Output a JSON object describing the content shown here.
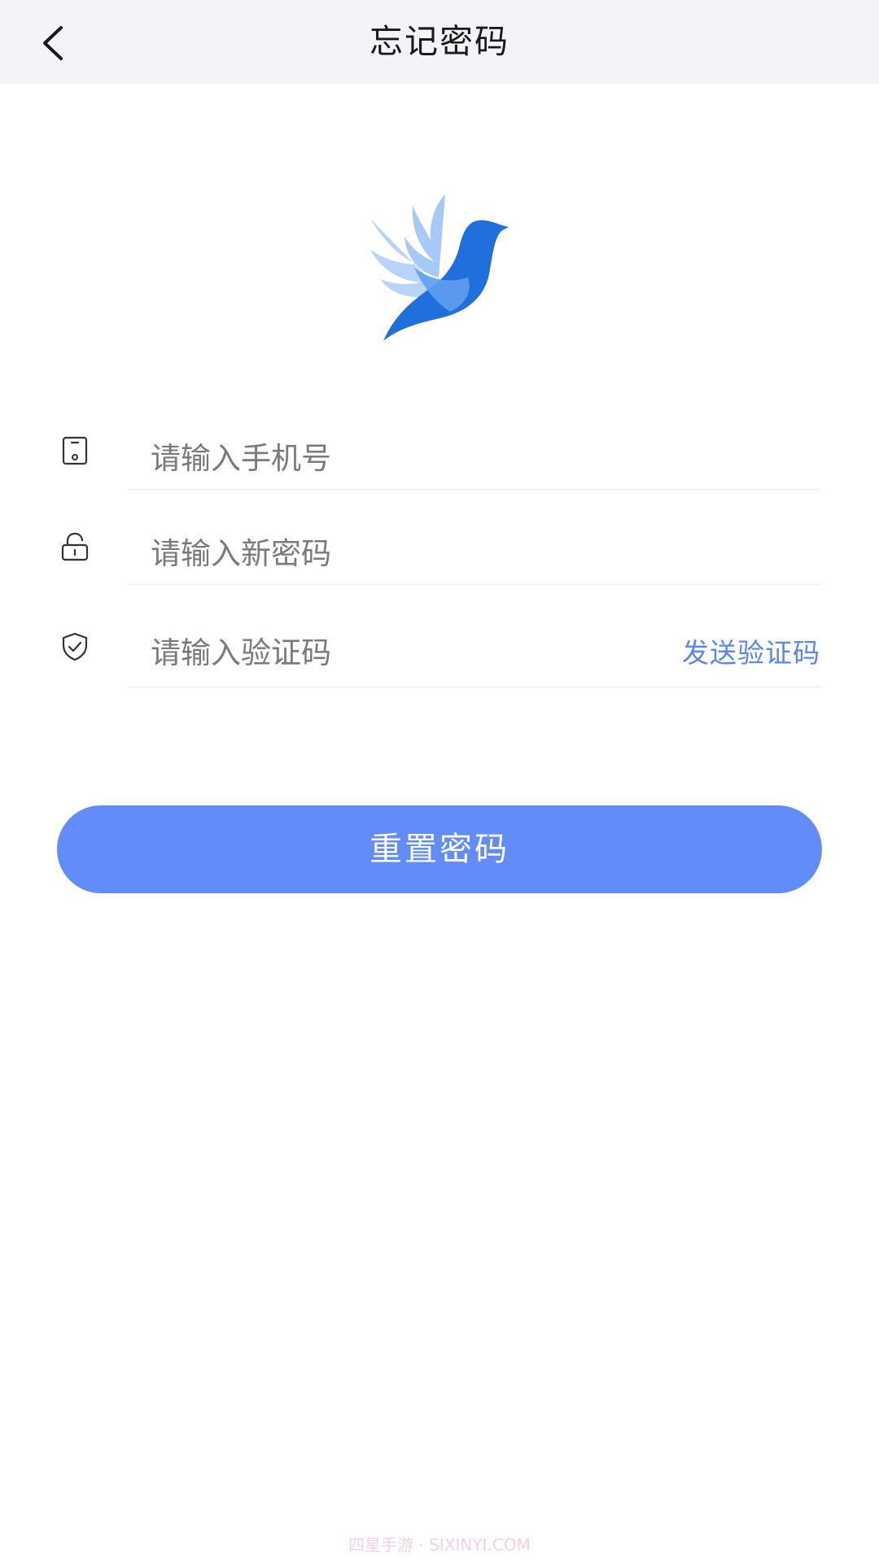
{
  "navbar": {
    "title": "忘记密码",
    "back_icon": "chevron-left-icon"
  },
  "logo": {
    "icon": "bird-logo-icon",
    "colors": {
      "primary": "#1f6fdd",
      "wing_light": "#9dc3f4",
      "wing_mid": "#5f9ff0"
    }
  },
  "form": {
    "phone": {
      "placeholder": "请输入手机号",
      "icon": "phone-icon"
    },
    "password": {
      "placeholder": "请输入新密码",
      "icon": "lock-icon"
    },
    "code": {
      "placeholder": "请输入验证码",
      "icon": "shield-check-icon",
      "send_label": "发送验证码"
    }
  },
  "submit": {
    "label": "重置密码",
    "color": "#628cf9"
  },
  "watermark": "四星手游 · SIXINYI.COM"
}
